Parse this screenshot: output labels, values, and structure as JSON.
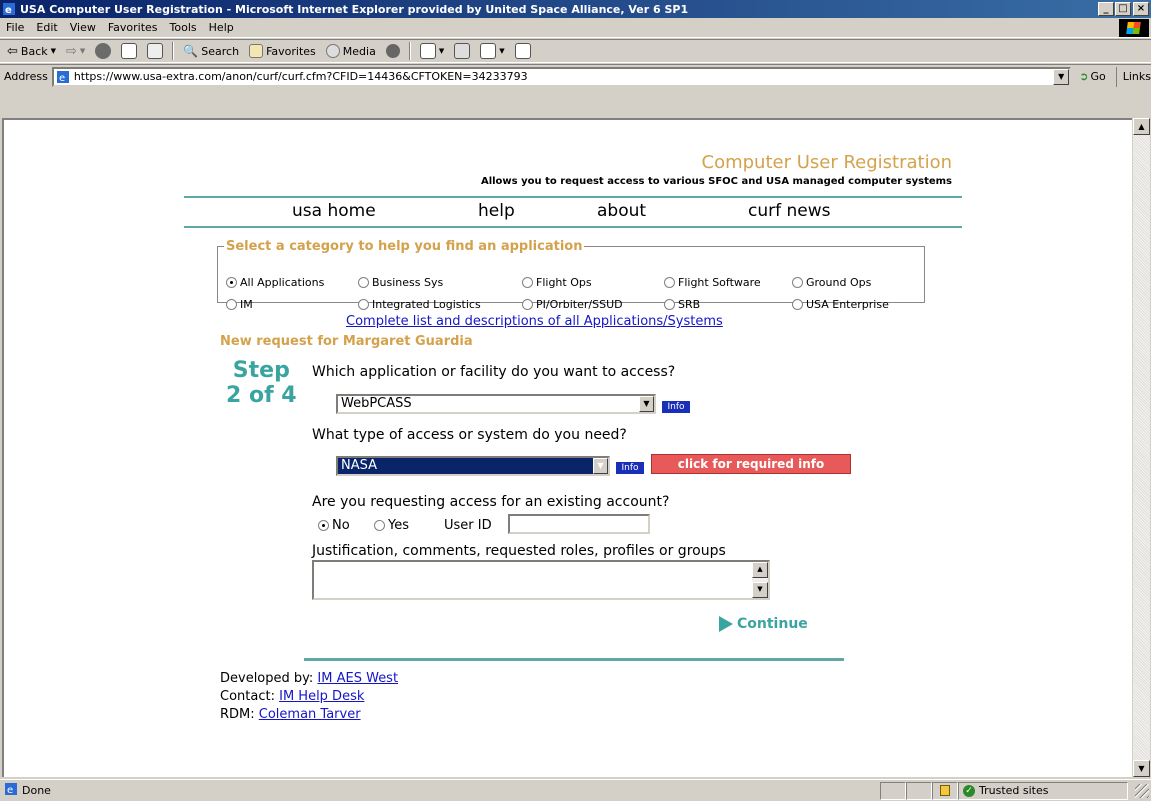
{
  "window": {
    "title": "USA Computer User Registration - Microsoft Internet Explorer provided by United Space Alliance, Ver 6 SP1",
    "min_label": "_",
    "max_label": "□",
    "close_label": "×"
  },
  "menu": {
    "items": [
      "File",
      "Edit",
      "View",
      "Favorites",
      "Tools",
      "Help"
    ]
  },
  "toolbar": {
    "back": "Back",
    "search": "Search",
    "favorites": "Favorites",
    "media": "Media"
  },
  "address": {
    "label": "Address",
    "url": "https://www.usa-extra.com/anon/curf/curf.cfm?CFID=14436&CFTOKEN=34233793",
    "go": "Go",
    "links": "Links"
  },
  "page": {
    "header_title": "Computer User Registration",
    "header_sub": "Allows you to request access to various SFOC and USA managed computer systems",
    "nav": [
      "usa home",
      "help",
      "about",
      "curf news"
    ],
    "category_legend": "Select a category to help you find an application",
    "categories": [
      {
        "label": "All Applications",
        "selected": true
      },
      {
        "label": "Business Sys",
        "selected": false
      },
      {
        "label": "Flight Ops",
        "selected": false
      },
      {
        "label": "Flight Software",
        "selected": false
      },
      {
        "label": "Ground Ops",
        "selected": false
      },
      {
        "label": "IM",
        "selected": false
      },
      {
        "label": "Integrated Logistics",
        "selected": false
      },
      {
        "label": "PI/Orbiter/SSUD",
        "selected": false
      },
      {
        "label": "SRB",
        "selected": false
      },
      {
        "label": "USA Enterprise",
        "selected": false
      }
    ],
    "complete_link": "Complete list and descriptions of all Applications/Systems",
    "new_request": "New request for Margaret Guardia",
    "step_word": "Step",
    "step_num": "2 of 4",
    "q1": "Which application or facility do you want to access?",
    "app_value": "WebPCASS",
    "info_label": "Info",
    "q2": "What type of access or system do you need?",
    "access_value": "NASA",
    "required_info_btn": "click for required info",
    "q3": "Are you requesting access for an existing account?",
    "existing": {
      "no_label": "No",
      "yes_label": "Yes",
      "selected": "No",
      "userid_label": "User ID",
      "userid_value": ""
    },
    "q4": "Justification, comments, requested roles, profiles or groups",
    "justification_value": "",
    "continue_label": "Continue",
    "footer": {
      "developed_label": "Developed by:",
      "developed_link": "IM AES West",
      "contact_label": "Contact:",
      "contact_link": "IM Help Desk",
      "rdm_label": "RDM:",
      "rdm_link": "Coleman Tarver"
    }
  },
  "status": {
    "text": "Done",
    "zone": "Trusted sites"
  },
  "colors": {
    "accent_gold": "#d4a24c",
    "teal": "#3aa4a0",
    "link_blue": "#1515c8",
    "required_red": "#e85a5a"
  }
}
